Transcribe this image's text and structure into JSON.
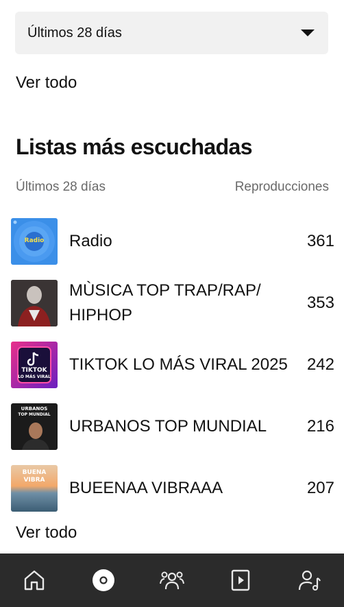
{
  "filter": {
    "selected": "Últimos 28 días"
  },
  "see_all_top": "Ver todo",
  "section": {
    "title": "Listas más escuchadas",
    "period_label": "Últimos 28 días",
    "plays_label": "Reproducciones"
  },
  "playlists": [
    {
      "name": "Radio",
      "plays": "361",
      "cover_text": "Radio"
    },
    {
      "name": "MÙSICA TOP TRAP/RAP/ HIPHOP",
      "plays": "353"
    },
    {
      "name": "TIKTOK LO MÁS VIRAL 2025",
      "plays": "242",
      "cover_text": "TIKTOK",
      "cover_sub": "LO MÁS VIRAL"
    },
    {
      "name": "URBANOS TOP MUNDIAL",
      "plays": "216",
      "cover_text": "URBANOS",
      "cover_sub": "TOP MUNDIAL"
    },
    {
      "name": "BUEENAA VIBRAAA",
      "plays": "207",
      "cover_text": "BUENA",
      "cover_sub": "VIBRA"
    }
  ],
  "see_all_bottom": "Ver todo",
  "nav": {
    "items": [
      "home-icon",
      "music-disc-icon",
      "audience-icon",
      "video-icon",
      "artist-profile-icon"
    ],
    "active": "music-disc-icon"
  },
  "colors": {
    "navbar": "#2b2b2b",
    "dropdown_bg": "#f1f1f1",
    "muted_text": "#6a6a6a",
    "radio_cover": "#3b8fe8"
  }
}
